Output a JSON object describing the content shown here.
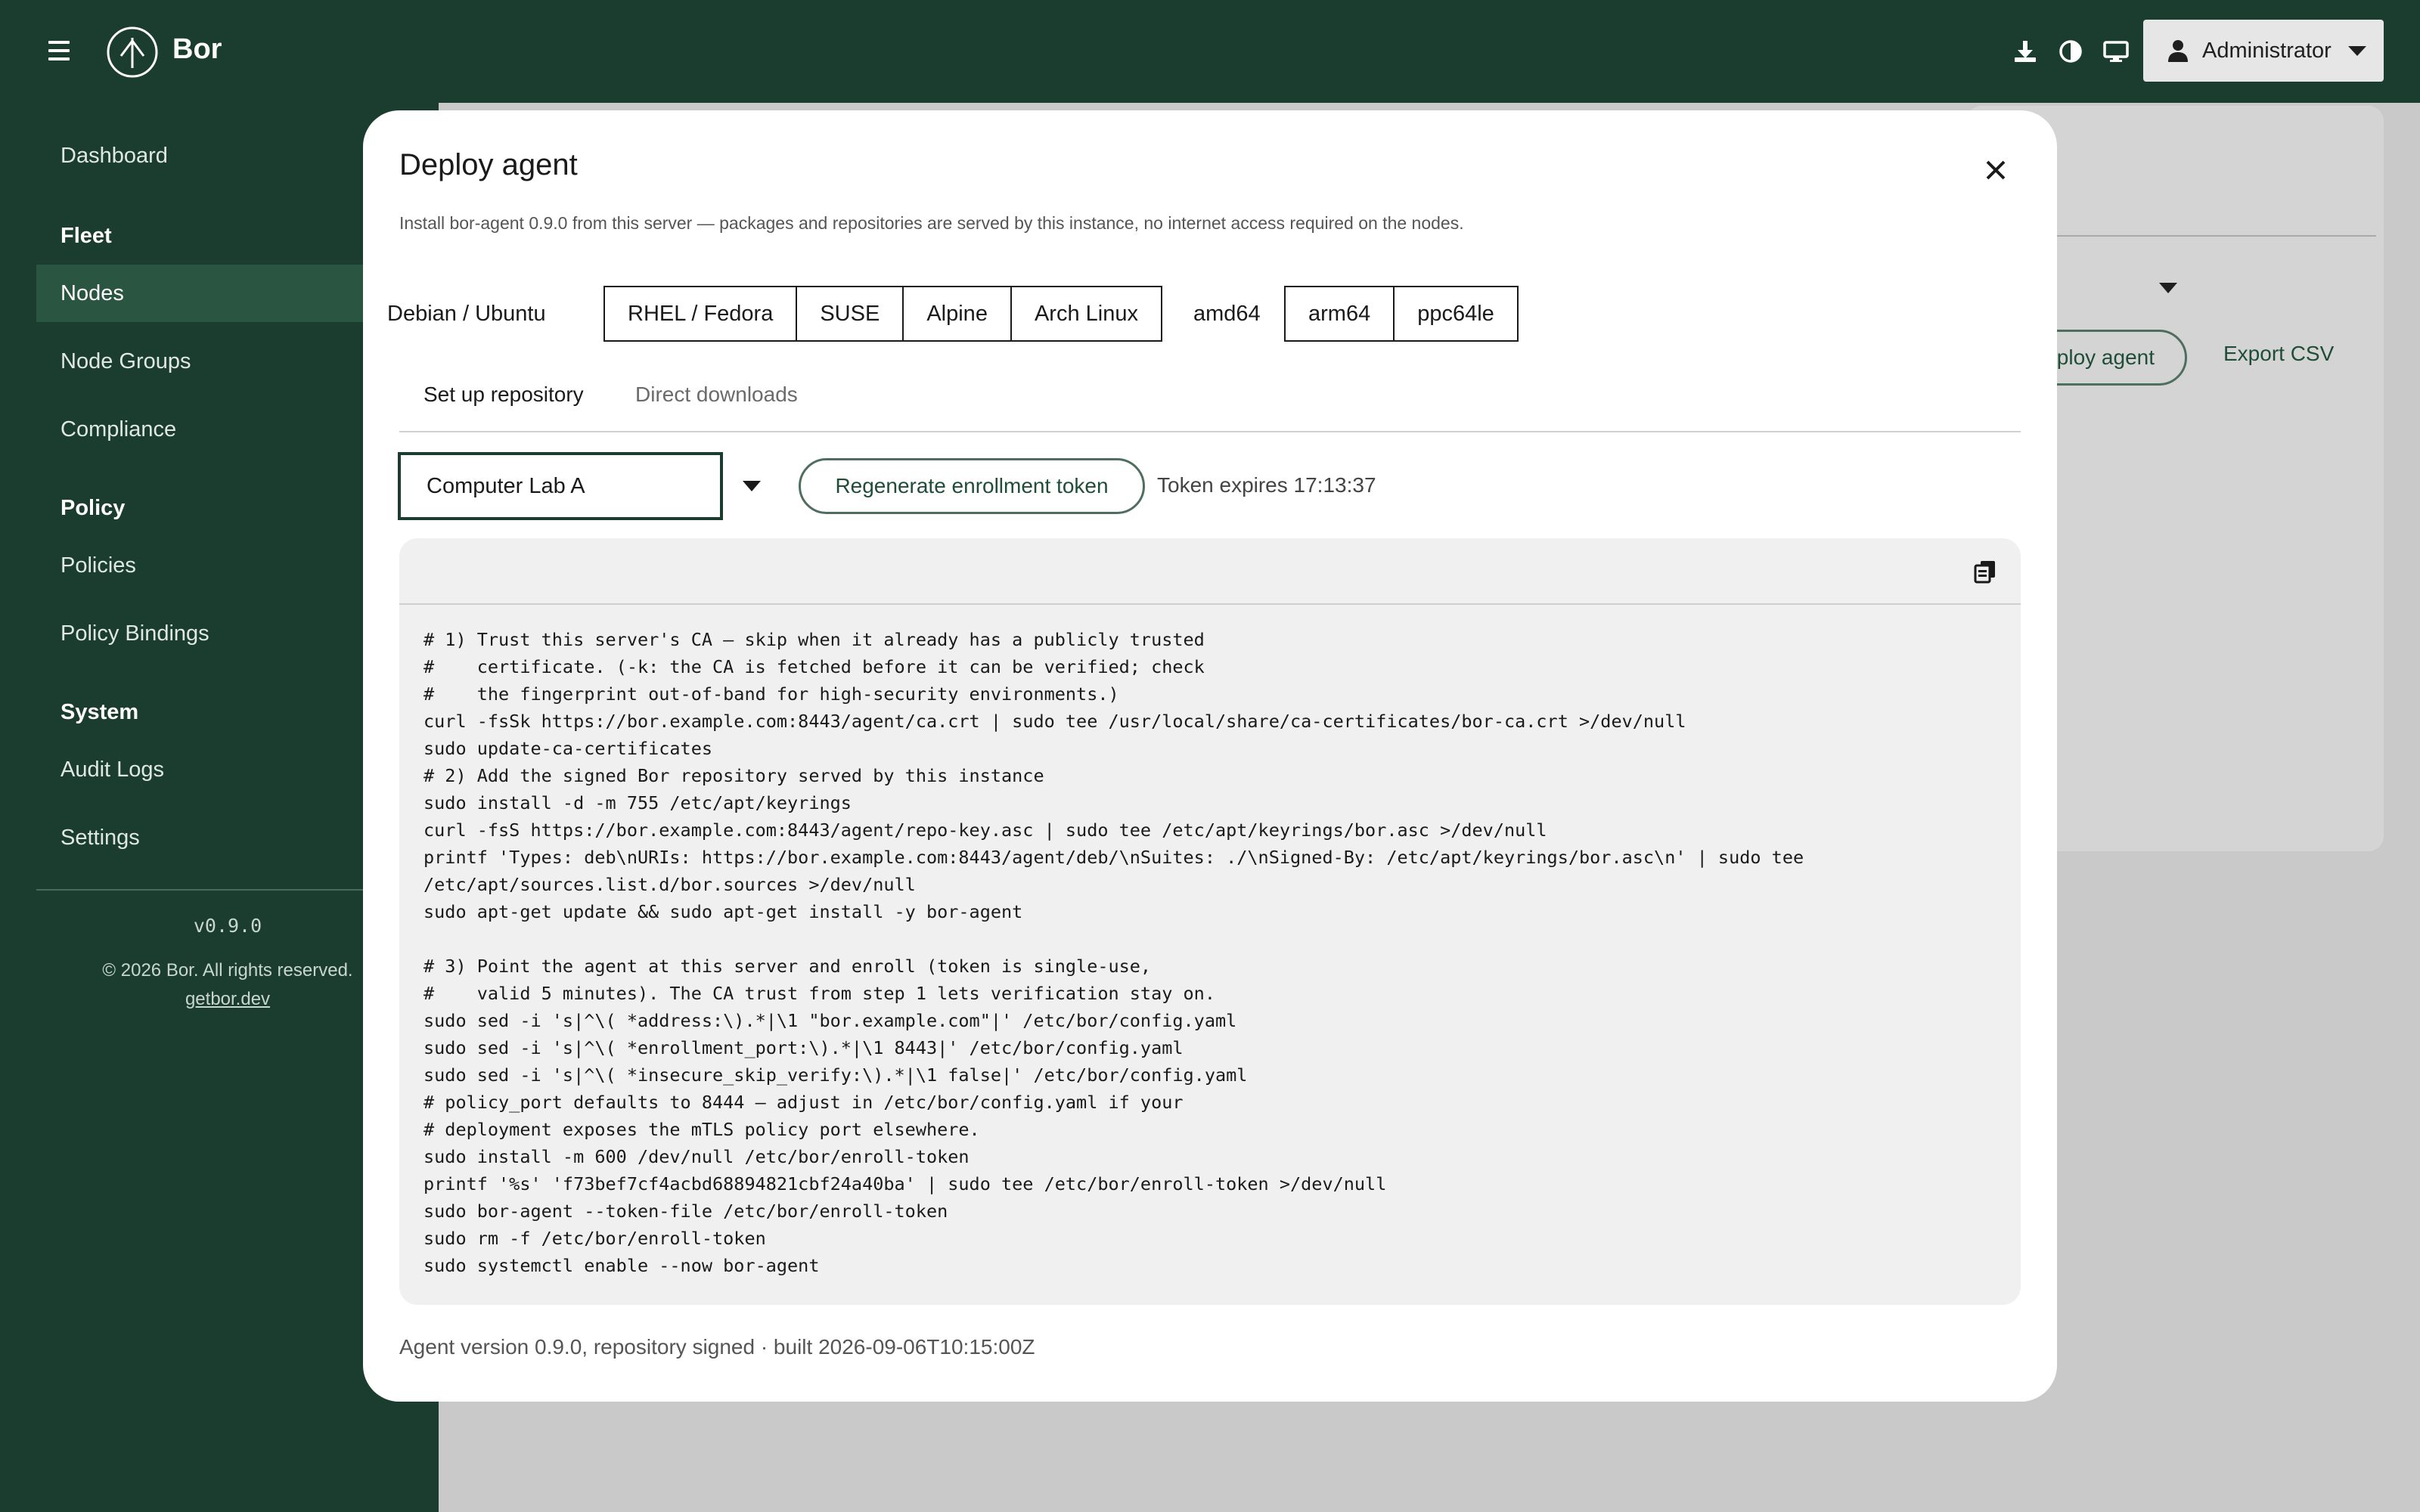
{
  "header": {
    "brand": "Bor",
    "user_label": "Administrator",
    "icons": [
      "menu-icon",
      "download-icon",
      "contrast-icon",
      "monitor-icon",
      "user-icon"
    ]
  },
  "sidebar": {
    "version": "v0.9.0",
    "copyright": "© 2026 Bor. All rights reserved.",
    "link": "getbor.dev",
    "items": {
      "dashboard": "Dashboard",
      "fleet_heading": "Fleet",
      "nodes": "Nodes",
      "node_groups": "Node Groups",
      "compliance": "Compliance",
      "policy_heading": "Policy",
      "policies": "Policies",
      "policy_bindings": "Policy Bindings",
      "system_heading": "System",
      "audit_logs": "Audit Logs",
      "settings": "Settings"
    },
    "active_item": "Nodes"
  },
  "background": {
    "deploy_button": "ploy agent",
    "export_button": "Export CSV"
  },
  "modal": {
    "title": "Deploy agent",
    "subtitle": "Install bor-agent 0.9.0 from this server — packages and repositories are served by this instance, no internet access required on the nodes.",
    "os_options": [
      "Debian / Ubuntu",
      "RHEL / Fedora",
      "SUSE",
      "Alpine",
      "Arch Linux"
    ],
    "os_selected": "Debian / Ubuntu",
    "arch_options": [
      "amd64",
      "arm64",
      "ppc64le"
    ],
    "arch_selected": "amd64",
    "tabs": [
      "Set up repository",
      "Direct downloads"
    ],
    "active_tab": "Set up repository",
    "group_input": {
      "value": "Computer Lab A"
    },
    "regenerate_button": "Regenerate enrollment token",
    "token_expiry": "Token expires 17:13:37",
    "script": "# 1) Trust this server's CA — skip when it already has a publicly trusted\n#    certificate. (-k: the CA is fetched before it can be verified; check\n#    the fingerprint out-of-band for high-security environments.)\ncurl -fsSk https://bor.example.com:8443/agent/ca.crt | sudo tee /usr/local/share/ca-certificates/bor-ca.crt >/dev/null\nsudo update-ca-certificates\n# 2) Add the signed Bor repository served by this instance\nsudo install -d -m 755 /etc/apt/keyrings\ncurl -fsS https://bor.example.com:8443/agent/repo-key.asc | sudo tee /etc/apt/keyrings/bor.asc >/dev/null\nprintf 'Types: deb\\nURIs: https://bor.example.com:8443/agent/deb/\\nSuites: ./\\nSigned-By: /etc/apt/keyrings/bor.asc\\n' | sudo tee\n/etc/apt/sources.list.d/bor.sources >/dev/null\nsudo apt-get update && sudo apt-get install -y bor-agent\n\n# 3) Point the agent at this server and enroll (token is single-use,\n#    valid 5 minutes). The CA trust from step 1 lets verification stay on.\nsudo sed -i 's|^\\( *address:\\).*|\\1 \"bor.example.com\"|' /etc/bor/config.yaml\nsudo sed -i 's|^\\( *enrollment_port:\\).*|\\1 8443|' /etc/bor/config.yaml\nsudo sed -i 's|^\\( *insecure_skip_verify:\\).*|\\1 false|' /etc/bor/config.yaml\n# policy_port defaults to 8444 — adjust in /etc/bor/config.yaml if your\n# deployment exposes the mTLS policy port elsewhere.\nsudo install -m 600 /dev/null /etc/bor/enroll-token\nprintf '%s' 'f73bef7cf4acbd68894821cbf24a40ba' | sudo tee /etc/bor/enroll-token >/dev/null\nsudo bor-agent --token-file /etc/bor/enroll-token\nsudo rm -f /etc/bor/enroll-token\nsudo systemctl enable --now bor-agent",
    "footer": "Agent version 0.9.0, repository signed · built 2026-09-06T10:15:00Z"
  }
}
